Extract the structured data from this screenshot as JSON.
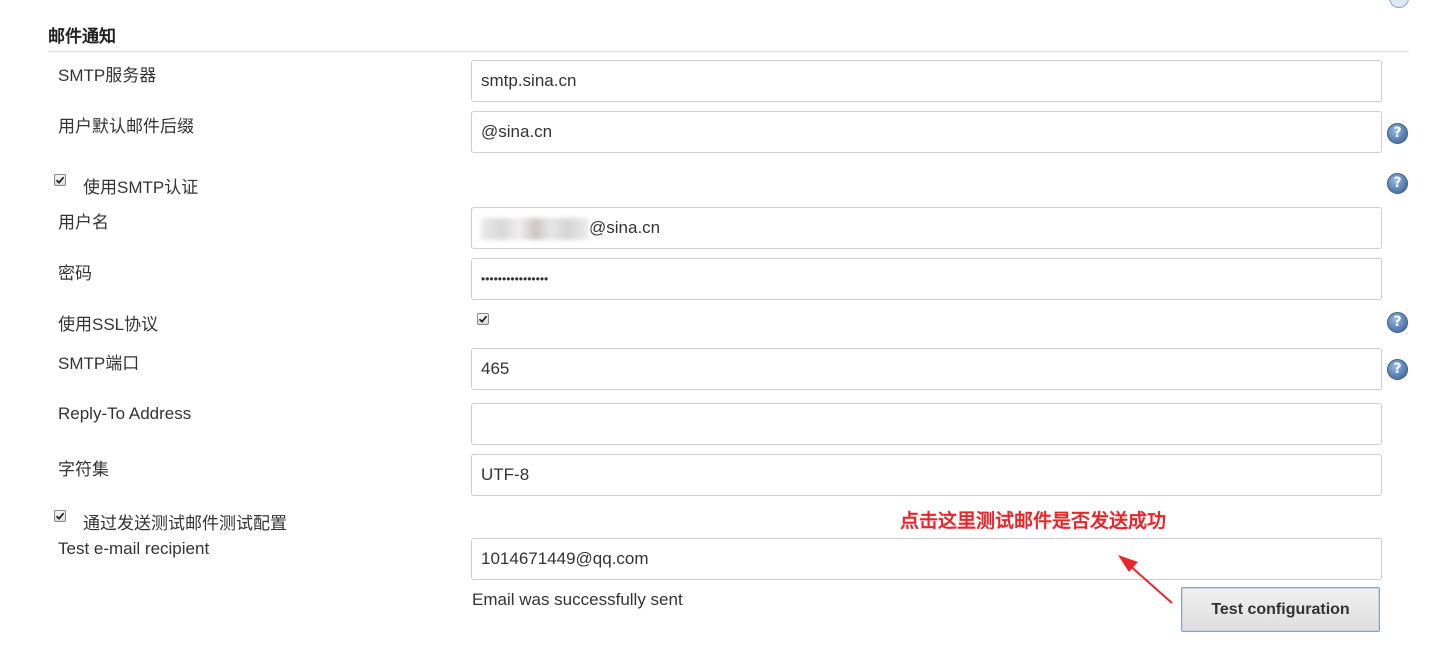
{
  "section": {
    "title": "邮件通知"
  },
  "fields": {
    "smtp_server": {
      "label": "SMTP服务器",
      "value": "smtp.sina.cn"
    },
    "default_suffix": {
      "label": "用户默认邮件后缀",
      "value": "@sina.cn"
    },
    "use_smtp_auth": {
      "label": "使用SMTP认证",
      "checked": true
    },
    "username": {
      "label": "用户名",
      "value": "@sina.cn"
    },
    "password": {
      "label": "密码",
      "value": "••••••••••••••••"
    },
    "use_ssl": {
      "label": "使用SSL协议",
      "checked": true
    },
    "smtp_port": {
      "label": "SMTP端口",
      "value": "465"
    },
    "reply_to": {
      "label": "Reply-To Address",
      "value": ""
    },
    "charset": {
      "label": "字符集",
      "value": "UTF-8"
    },
    "test_by_email": {
      "label": "通过发送测试邮件测试配置",
      "checked": true
    },
    "test_recipient": {
      "label": "Test e-mail recipient",
      "value": "1014671449@qq.com"
    }
  },
  "status": {
    "message": "Email was successfully sent"
  },
  "buttons": {
    "test_configuration": "Test configuration"
  },
  "annotation": {
    "text": "点击这里测试邮件是否发送成功",
    "color": "#e8262a"
  },
  "help_icon": {
    "glyph": "?",
    "icon": "question-mark-circle"
  }
}
